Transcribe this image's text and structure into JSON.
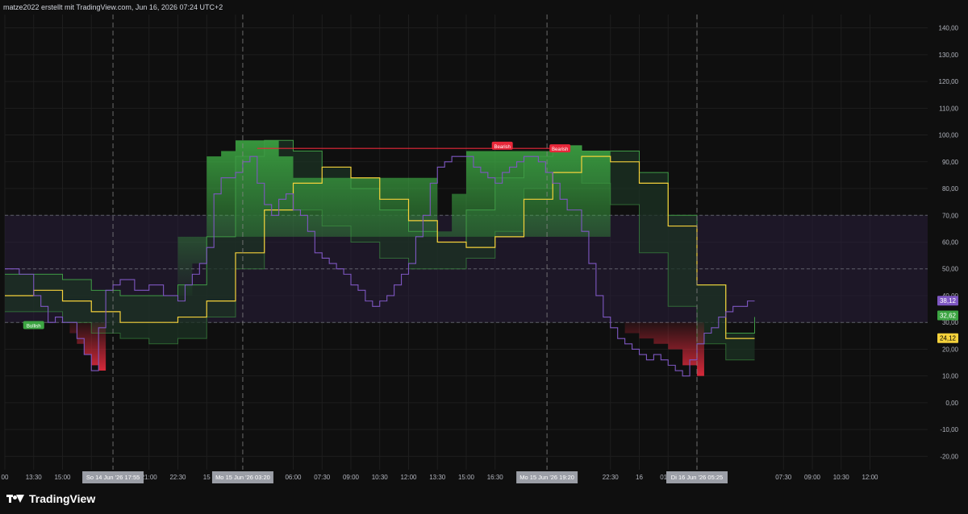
{
  "header": {
    "text": "matze2022 erstellt mit TradingView.com, Jun 16, 2026 07:24 UTC+2"
  },
  "brand": {
    "name": "TradingView"
  },
  "colors": {
    "background": "#0f0f0f",
    "grid": "#1e1e1e",
    "rsi_line": "#7e57c2",
    "signal_line": "#f5d13b",
    "band_edge": "#3f9a45",
    "bullish_fill": "#3ca542",
    "bearish_fill": "#e02a3c",
    "zone_fill": "#2a1f3d",
    "zone_border": "#787b86",
    "resistance_line": "#e8283a"
  },
  "chart_data": {
    "type": "line",
    "y_axis": {
      "ylim": [
        -25,
        145
      ],
      "ticks": [
        "140,00",
        "130,00",
        "120,00",
        "110,00",
        "100,00",
        "90,00",
        "80,00",
        "70,00",
        "60,00",
        "50,00",
        "40,00",
        "30,00",
        "20,00",
        "10,00",
        "0,00",
        "-10,00",
        "-20,00"
      ],
      "tick_values": [
        140,
        130,
        120,
        110,
        100,
        90,
        80,
        70,
        60,
        50,
        40,
        30,
        20,
        10,
        0,
        -10,
        -20
      ]
    },
    "x_axis": {
      "ticks": [
        "00",
        "13:30",
        "15:00",
        "1",
        "21:00",
        "22:30",
        "15",
        "01:",
        "06:00",
        "07:30",
        "09:00",
        "10:30",
        "12:00",
        "13:30",
        "15:00",
        "16:30",
        "22:30",
        "16",
        "01:30",
        "03:00",
        "07:30",
        "09:00",
        "10:30",
        "12:00"
      ],
      "tick_x": [
        0,
        2,
        4,
        6,
        10,
        12,
        14,
        16,
        20,
        22,
        24,
        26,
        28,
        30,
        32,
        34,
        42,
        44,
        46,
        48,
        54,
        56,
        58,
        60
      ],
      "highlight_labels": [
        {
          "text": "So 14 Jun '26   17:55",
          "x": 7.5
        },
        {
          "text": "Mo 15 Jun '26   03:20",
          "x": 16.5
        },
        {
          "text": "Mo 15 Jun '26   19:20",
          "x": 37.6
        },
        {
          "text": "Di 16 Jun '26   05:25",
          "x": 48.0
        }
      ],
      "xlim": [
        0,
        64
      ]
    },
    "reference_levels": {
      "zone": [
        30,
        70
      ],
      "mid": 50
    },
    "series": [
      {
        "key": "rsi",
        "x": [
          0,
          1,
          2,
          2.5,
          3,
          3.5,
          4,
          5,
          5.5,
          6,
          6.5,
          7,
          7.5,
          8,
          9,
          10,
          11,
          12,
          12.5,
          13,
          13.5,
          14,
          14.5,
          15,
          15.5,
          16,
          16.5,
          17,
          17.5,
          18,
          18.5,
          19,
          19.5,
          20,
          20.5,
          21,
          21.5,
          22,
          22.5,
          23,
          23.5,
          24,
          24.5,
          25,
          25.5,
          26,
          26.5,
          27,
          27.5,
          28,
          28.5,
          29,
          29.5,
          30,
          30.5,
          31,
          31.5,
          32,
          32.5,
          33,
          33.5,
          34,
          34.5,
          35,
          35.5,
          36,
          36.5,
          37,
          37.5,
          38,
          38.5,
          39,
          39.5,
          40,
          40.5,
          41,
          41.5,
          42,
          42.5,
          43,
          43.5,
          44,
          44.5,
          45,
          45.5,
          46,
          46.5,
          47,
          47.5,
          48,
          48.5,
          49,
          49.5,
          50,
          50.5,
          51,
          51.5,
          52
        ],
        "y": [
          50,
          48,
          40,
          36,
          30,
          32,
          30,
          24,
          18,
          12,
          28,
          42,
          44,
          46,
          42,
          44,
          40,
          38,
          44,
          48,
          52,
          58,
          78,
          84,
          84,
          86,
          90,
          92,
          82,
          74,
          70,
          76,
          78,
          72,
          70,
          64,
          56,
          54,
          52,
          50,
          48,
          44,
          42,
          38,
          36,
          38,
          40,
          44,
          48,
          52,
          62,
          70,
          82,
          88,
          90,
          92,
          92,
          92,
          88,
          86,
          84,
          82,
          86,
          88,
          90,
          92,
          92,
          90,
          86,
          82,
          76,
          72,
          72,
          64,
          52,
          40,
          32,
          28,
          24,
          22,
          20,
          18,
          16,
          18,
          16,
          14,
          12,
          10,
          16,
          22,
          26,
          28,
          32,
          34,
          36,
          36,
          38,
          38
        ],
        "color": "#7e57c2"
      },
      {
        "key": "signal",
        "x": [
          0,
          2,
          4,
          6,
          8,
          10,
          12,
          14,
          16,
          18,
          20,
          22,
          24,
          26,
          28,
          30,
          32,
          34,
          36,
          38,
          40,
          42,
          44,
          46,
          48,
          50,
          52
        ],
        "y": [
          40,
          42,
          38,
          34,
          30,
          30,
          32,
          38,
          56,
          72,
          82,
          88,
          84,
          76,
          68,
          60,
          58,
          62,
          76,
          86,
          92,
          90,
          82,
          66,
          44,
          24,
          24
        ],
        "color": "#f5d13b"
      },
      {
        "key": "band_upper",
        "x": [
          0,
          2,
          4,
          6,
          8,
          10,
          12,
          14,
          16,
          18,
          20,
          22,
          24,
          26,
          28,
          30,
          32,
          34,
          36,
          38,
          40,
          42,
          44,
          46,
          48,
          50,
          52
        ],
        "y": [
          48,
          48,
          46,
          42,
          40,
          40,
          44,
          62,
          92,
          98,
          94,
          88,
          80,
          72,
          64,
          60,
          72,
          84,
          92,
          96,
          94,
          94,
          86,
          70,
          44,
          26,
          32
        ],
        "color": "#3f9a45"
      },
      {
        "key": "band_lower",
        "x": [
          0,
          2,
          4,
          6,
          8,
          10,
          12,
          14,
          16,
          18,
          20,
          22,
          24,
          26,
          28,
          30,
          32,
          34,
          36,
          38,
          40,
          42,
          44,
          46,
          48,
          50,
          52
        ],
        "y": [
          34,
          34,
          30,
          26,
          24,
          22,
          24,
          32,
          50,
          72,
          72,
          66,
          60,
          54,
          50,
          50,
          54,
          64,
          80,
          86,
          82,
          74,
          56,
          36,
          22,
          16,
          16
        ],
        "color": "#3f9a45"
      },
      {
        "key": "fill_top",
        "x": [
          12,
          13,
          14,
          15,
          16,
          17,
          18,
          19,
          20,
          30,
          31,
          32,
          33,
          34,
          35,
          36,
          37,
          38,
          39,
          40,
          41,
          42
        ],
        "y": [
          40,
          52,
          92,
          94,
          98,
          98,
          98,
          92,
          84,
          64,
          78,
          94,
          94,
          94,
          94,
          94,
          94,
          96,
          96,
          94,
          94,
          94
        ],
        "color": "#3ca542"
      }
    ],
    "bear_zones": [
      {
        "x": [
          4,
          4.5,
          5,
          5.5,
          6,
          6.5,
          7
        ],
        "y": [
          30,
          26,
          22,
          18,
          14,
          12,
          30
        ]
      },
      {
        "x": [
          42,
          43,
          44,
          45,
          46,
          47,
          48,
          48.5
        ],
        "y": [
          30,
          26,
          24,
          22,
          20,
          14,
          10,
          30
        ]
      }
    ],
    "resistance": {
      "x": [
        17.5,
        38.5
      ],
      "y": [
        95,
        95
      ]
    },
    "markers": [
      {
        "label": "Bullish",
        "x": 2.0,
        "y": 29,
        "color": "#3ca542"
      },
      {
        "label": "Bearish",
        "x": 34.5,
        "y": 96,
        "color": "#e8283a"
      },
      {
        "label": "Bearish",
        "x": 38.5,
        "y": 95,
        "color": "#e8283a"
      }
    ],
    "vlines_x": [
      7.5,
      16.5,
      37.6,
      48.0
    ],
    "last_values": [
      {
        "text": "38,12",
        "value": 38.12,
        "color": "#7e57c2"
      },
      {
        "text": "32,62",
        "value": 32.62,
        "color": "#3ca542"
      },
      {
        "text": "24,12",
        "value": 24.12,
        "color": "#f5d13b"
      }
    ]
  }
}
